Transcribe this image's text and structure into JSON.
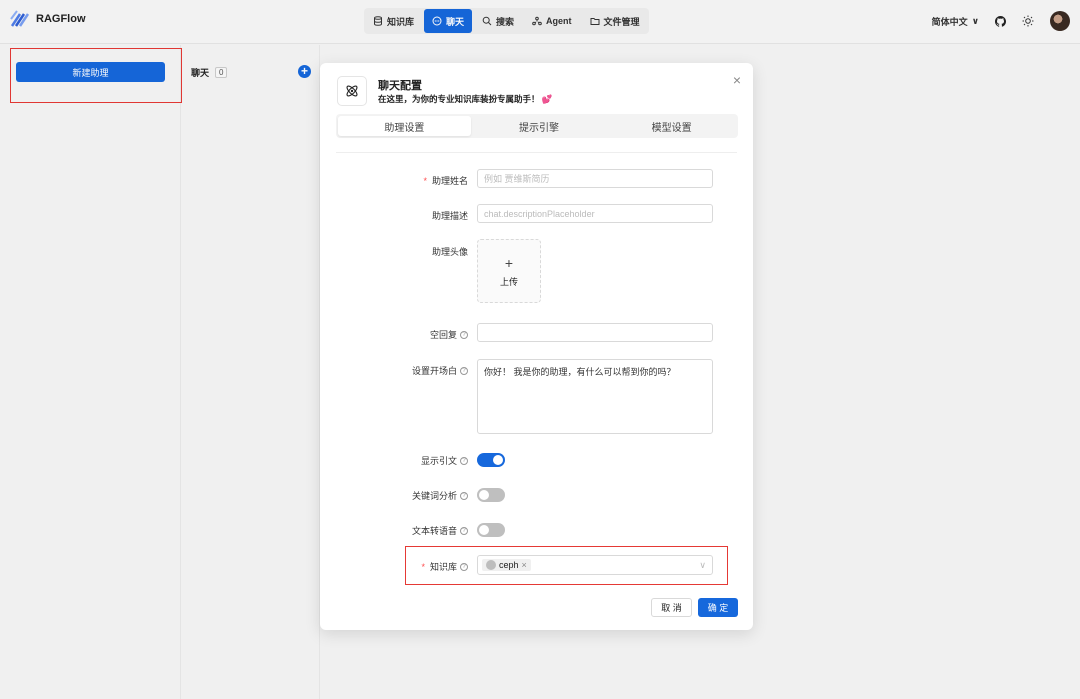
{
  "app": {
    "title": "RAGFlow"
  },
  "nav": [
    {
      "label": "知识库",
      "icon": "database-icon"
    },
    {
      "label": "聊天",
      "icon": "chat-icon",
      "active": true
    },
    {
      "label": "搜索",
      "icon": "search-icon"
    },
    {
      "label": "Agent",
      "icon": "agent-icon"
    },
    {
      "label": "文件管理",
      "icon": "folder-icon"
    }
  ],
  "header_right": {
    "language": "简体中文",
    "lang_chevron": "∨"
  },
  "sidebar": {
    "new_assistant_button": "新建助理",
    "chat_tab": "聊天",
    "chat_count": "0",
    "add": "+"
  },
  "modal": {
    "title": "聊天配置",
    "subtitle": "在这里，为你的专业知识库装扮专属助手！ 💕",
    "close": "×",
    "tabs": [
      "助理设置",
      "提示引擎",
      "模型设置"
    ],
    "fields": {
      "name": {
        "label": "助理姓名",
        "placeholder": "例如 贾维斯简历"
      },
      "description": {
        "label": "助理描述",
        "placeholder": "chat.descriptionPlaceholder"
      },
      "avatar": {
        "label": "助理头像",
        "upload_plus": "+",
        "upload_label": "上传"
      },
      "empty_reply": {
        "label": "空回复"
      },
      "opener": {
        "label": "设置开场白",
        "value": "你好！ 我是你的助理，有什么可以帮到你的吗？"
      },
      "show_quote": {
        "label": "显示引文",
        "on": true
      },
      "keyword_analysis": {
        "label": "关键词分析",
        "on": false
      },
      "tts": {
        "label": "文本转语音",
        "on": false
      },
      "knowledge_base": {
        "label": "知识库",
        "selected": "ceph",
        "chevron": "∨"
      }
    },
    "help_mark": "?",
    "required_mark": "*",
    "cancel": "取 消",
    "ok": "确 定"
  },
  "colors": {
    "primary": "#1668dc",
    "highlight_box": "#e53935"
  }
}
